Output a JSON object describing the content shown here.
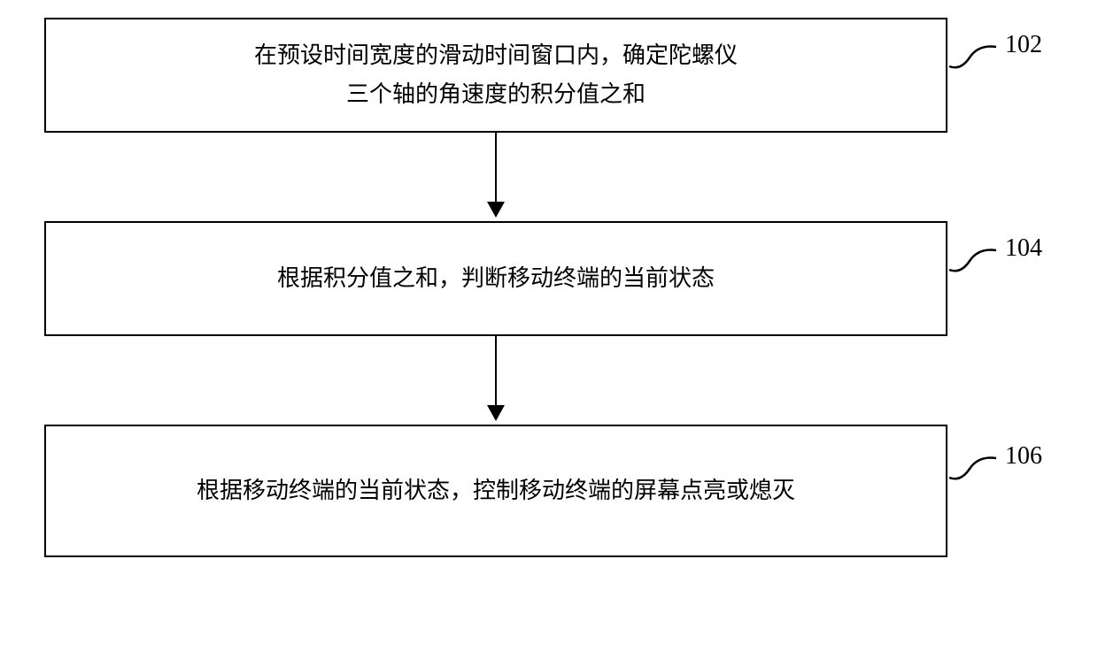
{
  "diagram": {
    "steps": [
      {
        "id": "102",
        "line1": "在预设时间宽度的滑动时间窗口内，确定陀螺仪",
        "line2": "三个轴的角速度的积分值之和",
        "label": "102"
      },
      {
        "id": "104",
        "line1": "根据积分值之和，判断移动终端的当前状态",
        "line2": "",
        "label": "104"
      },
      {
        "id": "106",
        "line1": "根据移动终端的当前状态，控制移动终端的屏幕点亮或熄灭",
        "line2": "",
        "label": "106"
      }
    ]
  }
}
